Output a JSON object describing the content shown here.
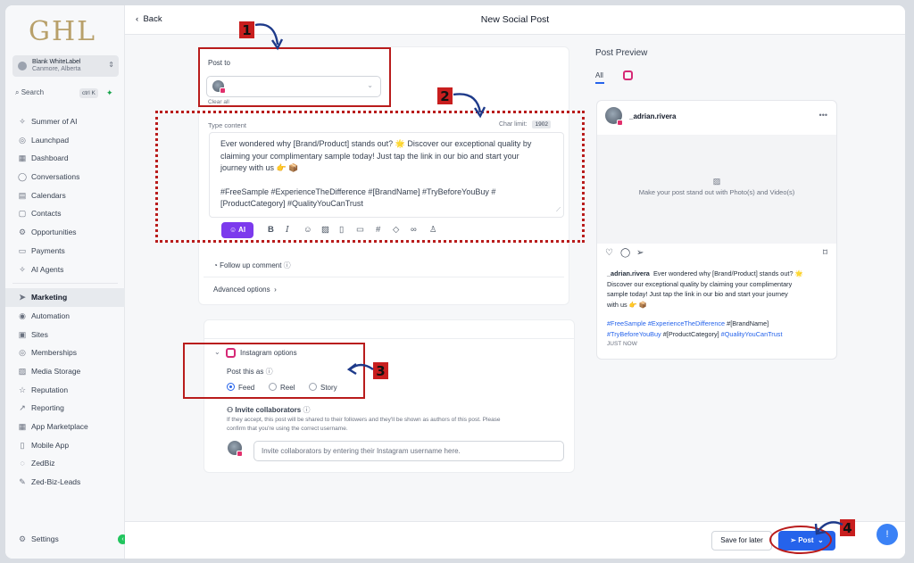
{
  "app": {
    "logo": "GHL"
  },
  "account": {
    "name": "Blank WhiteLabel",
    "location": "Canmore, Alberta"
  },
  "search": {
    "label": "Search",
    "shortcut": "ctrl K"
  },
  "sidebar": {
    "items": [
      {
        "label": "Summer of AI",
        "icon": "sparkle-icon",
        "glyph": "✧"
      },
      {
        "label": "Launchpad",
        "icon": "rocket-icon",
        "glyph": "◎"
      },
      {
        "label": "Dashboard",
        "icon": "dashboard-icon",
        "glyph": "▦"
      },
      {
        "label": "Conversations",
        "icon": "chat-icon",
        "glyph": "◯"
      },
      {
        "label": "Calendars",
        "icon": "calendar-icon",
        "glyph": "▤"
      },
      {
        "label": "Contacts",
        "icon": "contacts-icon",
        "glyph": "▢"
      },
      {
        "label": "Opportunities",
        "icon": "opportunities-icon",
        "glyph": "⚙"
      },
      {
        "label": "Payments",
        "icon": "payments-icon",
        "glyph": "▭"
      },
      {
        "label": "AI Agents",
        "icon": "ai-agents-icon",
        "glyph": "✧"
      }
    ],
    "items2": [
      {
        "label": "Marketing",
        "icon": "send-icon",
        "glyph": "➤",
        "active": true
      },
      {
        "label": "Automation",
        "icon": "automation-icon",
        "glyph": "◉"
      },
      {
        "label": "Sites",
        "icon": "sites-icon",
        "glyph": "▣"
      },
      {
        "label": "Memberships",
        "icon": "memberships-icon",
        "glyph": "◎"
      },
      {
        "label": "Media Storage",
        "icon": "media-icon",
        "glyph": "▨"
      },
      {
        "label": "Reputation",
        "icon": "star-icon",
        "glyph": "☆"
      },
      {
        "label": "Reporting",
        "icon": "reporting-icon",
        "glyph": "↗"
      },
      {
        "label": "App Marketplace",
        "icon": "marketplace-icon",
        "glyph": "▦"
      },
      {
        "label": "Mobile App",
        "icon": "mobile-icon",
        "glyph": "▯"
      },
      {
        "label": "ZedBiz",
        "icon": "zedbiz-icon",
        "glyph": "◌"
      },
      {
        "label": "Zed-Biz-Leads",
        "icon": "wrench-icon",
        "glyph": "✎"
      }
    ],
    "settings": "Settings"
  },
  "header": {
    "back": "Back",
    "title": "New Social Post"
  },
  "post": {
    "post_to_label": "Post to",
    "clear_all": "Clear all",
    "type_content_label": "Type content",
    "char_limit_label": "Char limit:",
    "char_limit_value": "1902",
    "content_line1": "Ever wondered why [Brand/Product] stands out? 🌟 Discover our exceptional quality by",
    "content_line2": "claiming your complimentary sample today! Just tap the link in our bio and start your",
    "content_line3": "journey with us 👉 📦",
    "content_line4": "#FreeSample #ExperienceTheDifference #[BrandName] #TryBeforeYouBuy #",
    "content_line5": "[ProductCategory] #QualityYouCanTrust",
    "ai_label": "AI",
    "follow_up": "Follow up comment",
    "advanced": "Advanced options"
  },
  "instagram": {
    "title": "Instagram options",
    "post_as": "Post this as",
    "options": [
      "Feed",
      "Reel",
      "Story"
    ],
    "selected": "Feed",
    "invite_title": "Invite collaborators",
    "invite_desc1": "If they accept, this post will be shared to their followers and they'll be shown as authors of this post. Please",
    "invite_desc2": "confirm that you're using the correct username.",
    "invite_placeholder": "Invite collaborators by entering their Instagram username here."
  },
  "preview": {
    "title": "Post Preview",
    "tab_all": "All",
    "username": "_adrian.rivera",
    "media_text": "Make your post stand out with Photo(s) and Video(s)",
    "caption1": "Ever wondered why [Brand/Product] stands out? 🌟",
    "caption2": "Discover our exceptional quality by claiming your complimentary",
    "caption3": "sample today! Just tap the link in our bio and start your journey",
    "caption4": "with us 👉 📦",
    "tag1": "#FreeSample",
    "tag2": "#ExperienceTheDifference",
    "tag3": "#[BrandName]",
    "tag4": "#TryBeforeYouBuy",
    "tag5": "#[ProductCategory]",
    "tag6": "#QualityYouCanTrust",
    "time": "JUST NOW"
  },
  "footer": {
    "save_later": "Save for later",
    "post": "Post"
  },
  "annotations": {
    "step1": "1",
    "step2": "2",
    "step3": "3",
    "step4": "4"
  },
  "colors": {
    "annotation_red": "#b91c1c",
    "accent_blue": "#2563eb",
    "ai_purple": "#7c3aed",
    "instagram": "#e1306c"
  }
}
